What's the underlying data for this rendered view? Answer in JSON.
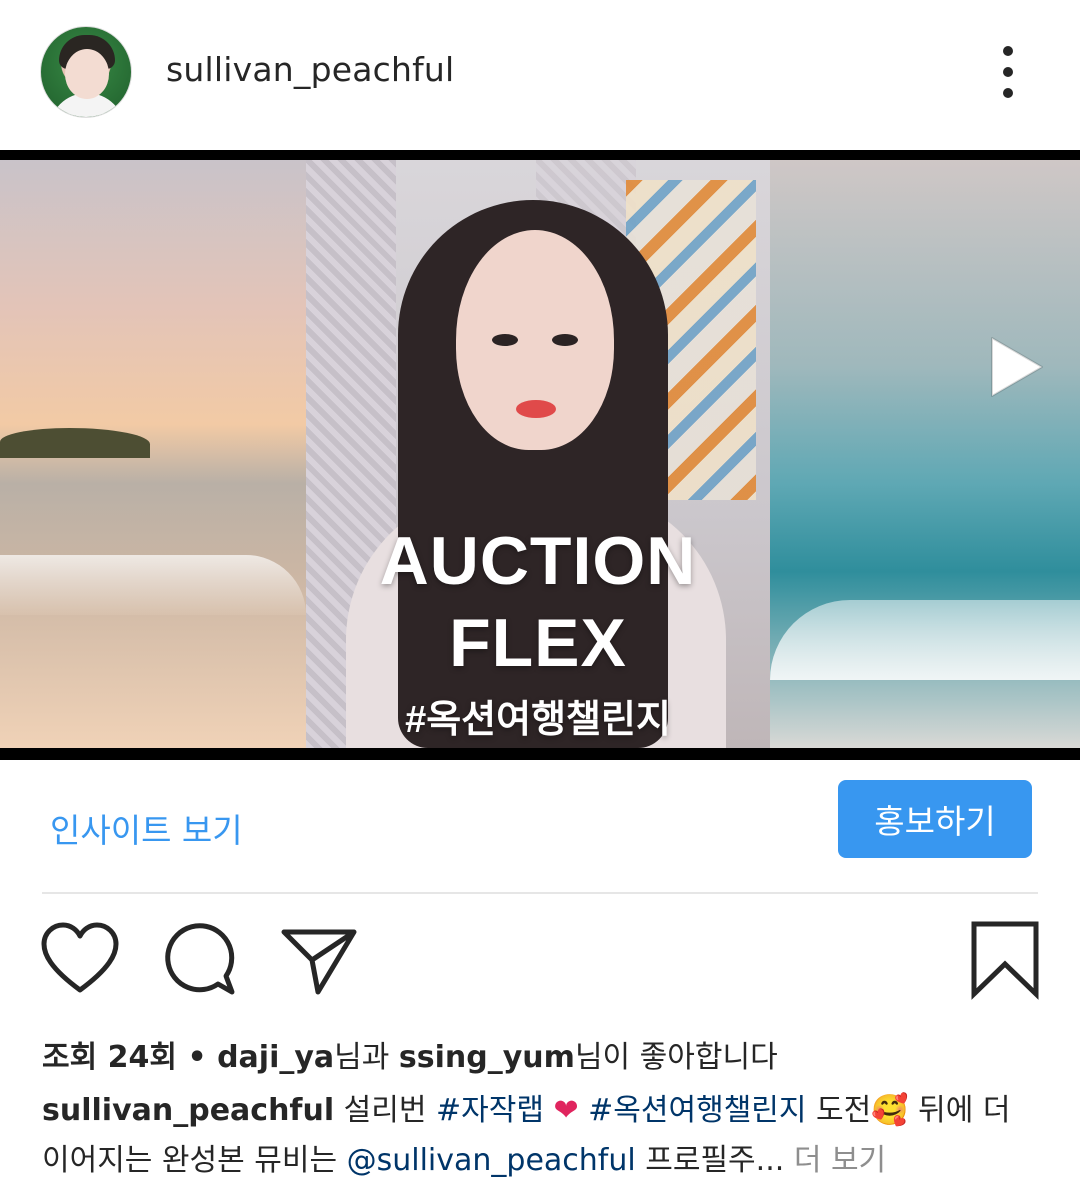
{
  "post": {
    "username": "sullivan_peachful",
    "media": {
      "title_line1": "AUCTION",
      "title_line2": "FLEX",
      "hashtag_text": "#옥션여행챌린지"
    },
    "insights_label": "인사이트 보기",
    "promote_label": "홍보하기",
    "likes": {
      "views_prefix": "조회 24회",
      "separator": " • ",
      "user1": "daji_ya",
      "and_text": "님과 ",
      "user2": "ssing_yum",
      "suffix": "님이 좋아합니다"
    },
    "caption": {
      "username": "sullivan_peachful",
      "text1": " 설리번 ",
      "tag1": "#자작랩",
      "heart": " ❤ ",
      "tag2": "#옥션여행챌린지",
      "text2": " 도전",
      "emoji": "🥰",
      "text3": " 뒤에 더 이어지는 완성본 뮤비는 ",
      "mention": "@sullivan_peachful",
      "text4": " 프로필주... ",
      "more": "더 보기"
    }
  },
  "icons": {
    "more": "more-vertical-icon",
    "play": "play-icon",
    "tag": "user-tag-icon",
    "like": "heart-icon",
    "comment": "comment-icon",
    "share": "send-icon",
    "save": "bookmark-icon"
  },
  "colors": {
    "accent": "#3897f0",
    "text": "#262626",
    "hashtag": "#003569",
    "muted": "#8e8e8e"
  }
}
